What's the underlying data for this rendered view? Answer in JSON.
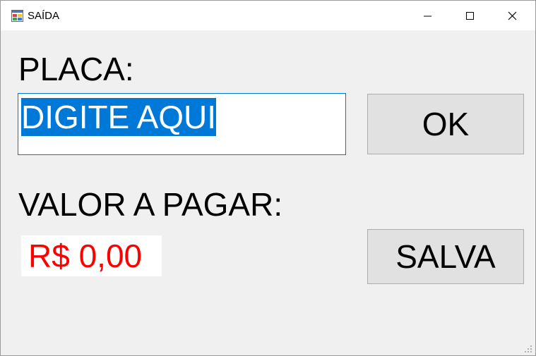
{
  "window": {
    "title": "SAÍDA",
    "icon": "app-form-icon",
    "controls": [
      "minimize-icon",
      "maximize-icon",
      "close-icon"
    ]
  },
  "form": {
    "placa_label": "PLACA:",
    "placa_value": "DIGITE AQUI",
    "valor_label": "VALOR A PAGAR:",
    "valor_value": "R$ 0,00",
    "ok_button": "OK",
    "salva_button": "SALVA"
  },
  "colors": {
    "selection": "#0078d7",
    "price_text": "#ff0000",
    "button_face": "#e1e1e1",
    "form_background": "#f0f0f0"
  }
}
